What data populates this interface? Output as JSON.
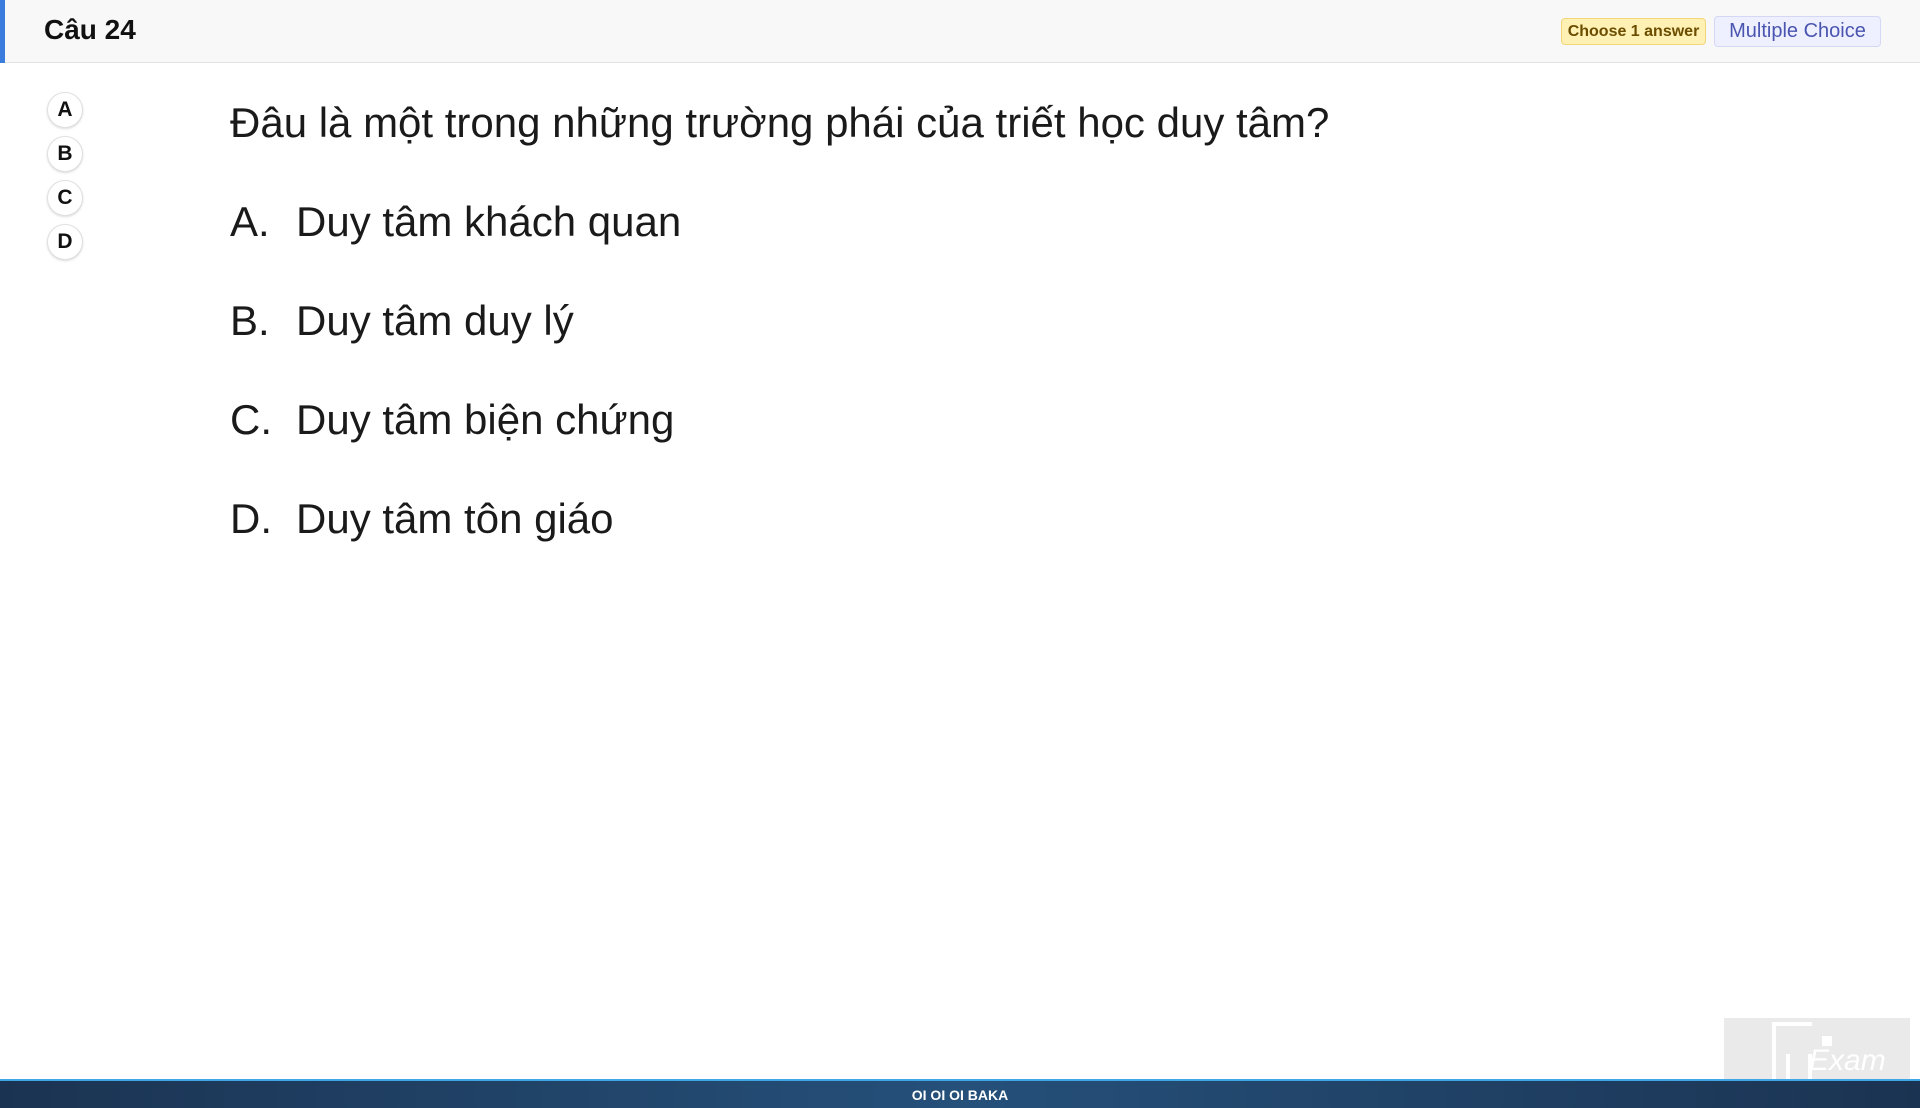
{
  "header": {
    "title": "Câu 24",
    "badge_choose": "Choose 1 answer",
    "badge_type": "Multiple Choice",
    "accent_color": "#3b7ddd"
  },
  "options": [
    "A",
    "B",
    "C",
    "D"
  ],
  "question": {
    "text": "Đâu là một trong những trường phái của triết học duy tâm?",
    "answers": [
      {
        "letter": "A.",
        "text": "Duy tâm khách quan"
      },
      {
        "letter": "B.",
        "text": "Duy tâm duy lý"
      },
      {
        "letter": "C.",
        "text": "Duy tâm biện chứng"
      },
      {
        "letter": "D.",
        "text": "Duy tâm tôn giáo"
      }
    ]
  },
  "footer": {
    "text": "OI OI OI BAKA"
  },
  "logo": {
    "text": "Exam"
  }
}
